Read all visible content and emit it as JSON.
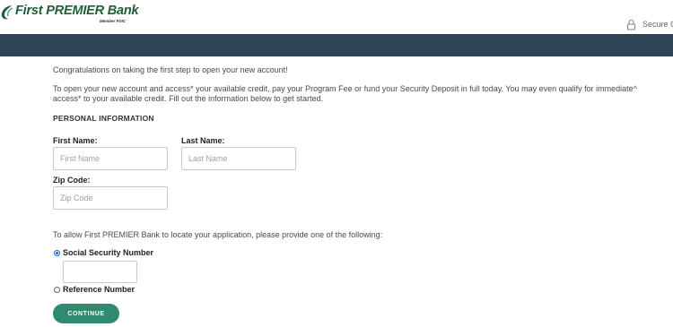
{
  "header": {
    "brand_name": "First PREMIER Bank",
    "brand_sub": "Member FDIC",
    "secure_label": "Secure C",
    "secure_icon": "lock-icon"
  },
  "colors": {
    "banner": "#2c4556",
    "brand": "#1f5e3b",
    "button": "#2f8a6f",
    "radio_selected": "#1e5fd8"
  },
  "intro": {
    "congrats": "Congratulations on taking the first step to open your new account!",
    "instructions_line1": "To open your new account and access* your available credit, pay your Program Fee or fund your Security Deposit in full today. You may even qualify for immediate^",
    "instructions_line2": "access* to your available credit. Fill out the information below to get started."
  },
  "personal": {
    "section_title": "PERSONAL INFORMATION",
    "first_name": {
      "label": "First Name:",
      "placeholder": "First Name",
      "value": ""
    },
    "last_name": {
      "label": "Last Name:",
      "placeholder": "Last Name",
      "value": ""
    },
    "zip_code": {
      "label": "Zip Code:",
      "placeholder": "Zip Code",
      "value": ""
    }
  },
  "locate": {
    "prompt": "To allow First PREMIER Bank to locate your application, please provide one of the following:",
    "options": [
      {
        "label": "Social Security Number",
        "selected": true
      },
      {
        "label": "Reference Number",
        "selected": false
      }
    ],
    "ssn_value": ""
  },
  "actions": {
    "continue_label": "CONTINUE"
  }
}
